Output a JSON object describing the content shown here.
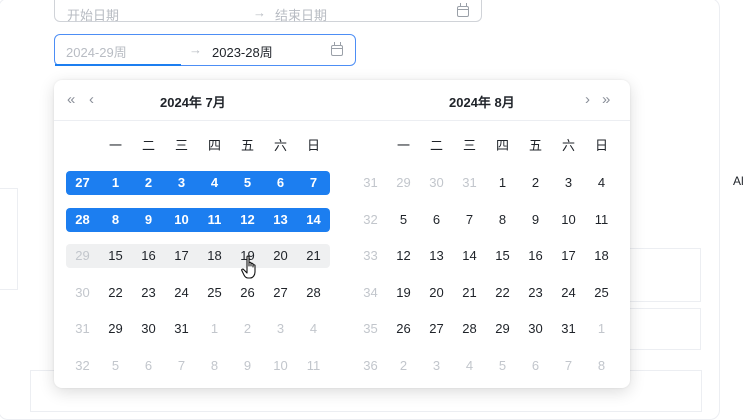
{
  "range_inputs": {
    "top": {
      "start_placeholder": "开始日期",
      "arrow": "→",
      "end_placeholder": "结束日期"
    },
    "active": {
      "start_value": "2024-29周",
      "arrow": "→",
      "end_value": "2023-28周"
    }
  },
  "weekdays": [
    "一",
    "二",
    "三",
    "四",
    "五",
    "六",
    "日"
  ],
  "left_calendar": {
    "title": "2024年  7月",
    "rows": [
      {
        "week": "27",
        "days": [
          "1",
          "2",
          "3",
          "4",
          "5",
          "6",
          "7"
        ],
        "state": "selected"
      },
      {
        "week": "28",
        "days": [
          "8",
          "9",
          "10",
          "11",
          "12",
          "13",
          "14"
        ],
        "state": "selected"
      },
      {
        "week": "29",
        "days": [
          "15",
          "16",
          "17",
          "18",
          "19",
          "20",
          "21"
        ],
        "state": "hover"
      },
      {
        "week": "30",
        "days": [
          "22",
          "23",
          "24",
          "25",
          "26",
          "27",
          "28"
        ],
        "state": "normal"
      },
      {
        "week": "31",
        "days": [
          "29",
          "30",
          "31",
          "1",
          "2",
          "3",
          "4"
        ],
        "state": "normal",
        "other_from": 3
      },
      {
        "week": "32",
        "days": [
          "5",
          "6",
          "7",
          "8",
          "9",
          "10",
          "11"
        ],
        "state": "normal",
        "other_from": 0
      }
    ]
  },
  "right_calendar": {
    "title": "2024年  8月",
    "rows": [
      {
        "week": "31",
        "days": [
          "29",
          "30",
          "31",
          "1",
          "2",
          "3",
          "4"
        ],
        "other_until": 3
      },
      {
        "week": "32",
        "days": [
          "5",
          "6",
          "7",
          "8",
          "9",
          "10",
          "11"
        ]
      },
      {
        "week": "33",
        "days": [
          "12",
          "13",
          "14",
          "15",
          "16",
          "17",
          "18"
        ]
      },
      {
        "week": "34",
        "days": [
          "19",
          "20",
          "21",
          "22",
          "23",
          "24",
          "25"
        ]
      },
      {
        "week": "35",
        "days": [
          "26",
          "27",
          "28",
          "29",
          "30",
          "31",
          "1"
        ],
        "other_from": 6
      },
      {
        "week": "36",
        "days": [
          "2",
          "3",
          "4",
          "5",
          "6",
          "7",
          "8"
        ],
        "other_from": 0
      }
    ]
  },
  "nav": {
    "prev_year": "«",
    "prev_month": "‹",
    "next_month": "›",
    "next_year": "»"
  },
  "side_text": "Al",
  "colors": {
    "selected": "#1c7ef0",
    "hover": "#eff0f1",
    "muted": "#c2c6cc"
  }
}
